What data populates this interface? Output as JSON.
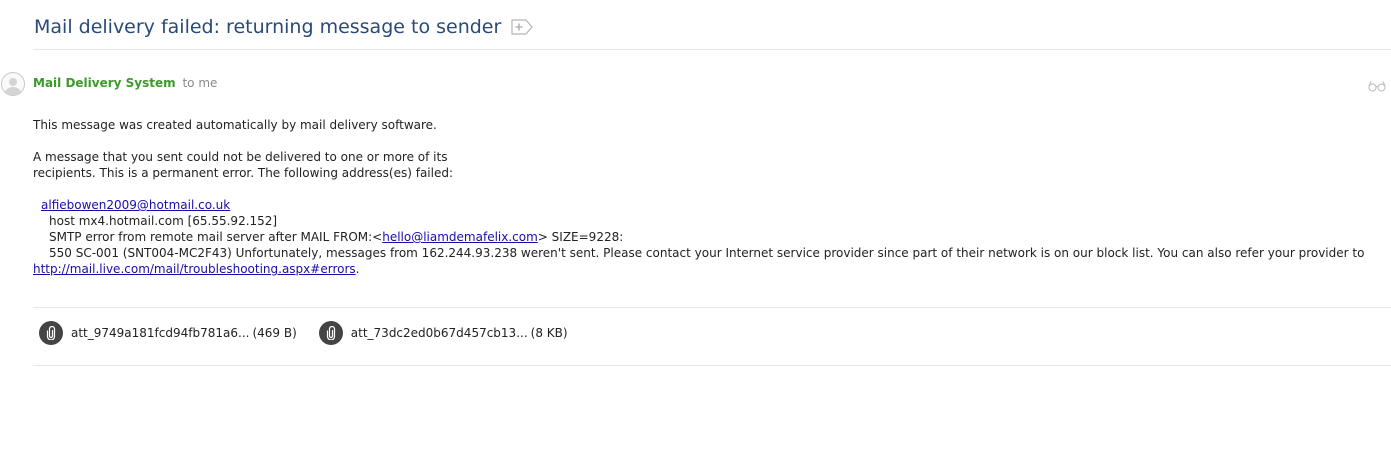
{
  "subject": "Mail delivery failed: returning message to sender",
  "sender": {
    "name": "Mail Delivery System",
    "recipient": "to me"
  },
  "body": {
    "line1": "This message was created automatically by mail delivery software.",
    "line2": "A message that you sent could not be delivered to one or more of its",
    "line3": "recipients. This is a permanent error. The following address(es) failed:",
    "failed_address": "alfiebowen2009@hotmail.co.uk",
    "host_line": "host mx4.hotmail.com [65.55.92.152]",
    "smtp_prefix": "SMTP error from remote mail server after MAIL FROM:<",
    "from_address": "hello@liamdemafelix.com",
    "smtp_suffix": "> SIZE=9228:",
    "error_line": "550 SC-001 (SNT004-MC2F43) Unfortunately, messages from 162.244.93.238 weren't sent. Please contact your Internet service provider since part of their network is on our block list. You can also refer your provider to",
    "help_link": "http://mail.live.com/mail/troubleshooting.aspx#errors",
    "help_link_suffix": "."
  },
  "attachments": [
    {
      "name": "att_9749a181fcd94fb781a6...",
      "size": "(469 B)",
      "icon": "paperclip-icon"
    },
    {
      "name": "att_73dc2ed0b67d457cb13...",
      "size": "(8 KB)",
      "icon": "paperclip-icon"
    }
  ],
  "colors": {
    "subject": "#2a4a78",
    "sender": "#3c9a2c",
    "link": "#1a0dab",
    "attachment_icon_bg": "#444444"
  }
}
